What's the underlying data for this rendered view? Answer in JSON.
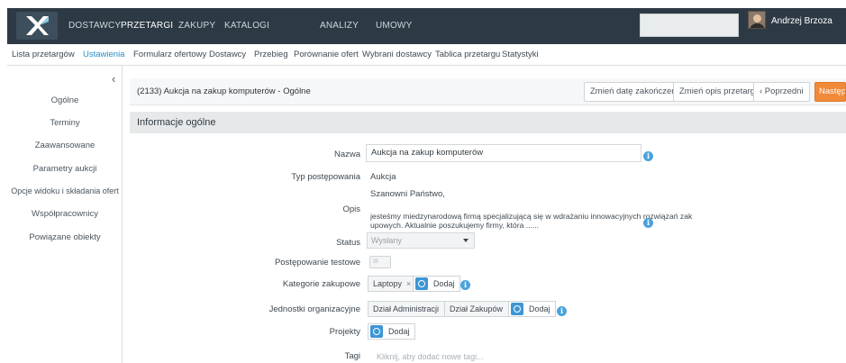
{
  "topbar": {
    "nav": [
      {
        "label": "DOSTAWCY",
        "active": false
      },
      {
        "label": "PRZETARGI",
        "active": true
      },
      {
        "label": "ZAKUPY",
        "active": false
      },
      {
        "label": "KATALOGI PRODUKTÓW",
        "active": false
      },
      {
        "label": "ANALIZY",
        "active": false
      },
      {
        "label": "UMOWY",
        "active": false
      }
    ],
    "user_name": "Andrzej Brzoza"
  },
  "subnav": {
    "tabs": [
      {
        "label": "Lista przetargów",
        "active": false
      },
      {
        "label": "Ustawienia",
        "active": true
      },
      {
        "label": "Formularz ofertowy",
        "active": false
      },
      {
        "label": "Dostawcy",
        "active": false
      },
      {
        "label": "Przebieg",
        "active": false
      },
      {
        "label": "Porównanie ofert",
        "active": false
      },
      {
        "label": "Wybrani dostawcy",
        "active": false
      },
      {
        "label": "Tablica przetargu",
        "active": false
      },
      {
        "label": "Statystyki",
        "active": false
      }
    ]
  },
  "sidebar": {
    "collapse_glyph": "‹",
    "items": [
      "Ogólne",
      "Terminy",
      "Zaawansowane",
      "Parametry aukcji",
      "Opcje widoku i składania ofert",
      "Współpracownicy",
      "Powiązane obiekty"
    ]
  },
  "header": {
    "title": "(2133) Aukcja na zakup komputerów - Ogólne",
    "buttons": {
      "change_end_date": "Zmień datę zakończenia",
      "change_description": "Zmień opis przetargu",
      "previous": "‹  Poprzedni",
      "next": "Następn"
    }
  },
  "section": {
    "title": "Informacje ogólne"
  },
  "form": {
    "name": {
      "label": "Nazwa",
      "value": "Aukcja na zakup komputerów"
    },
    "type": {
      "label": "Typ postępowania",
      "value": "Aukcja"
    },
    "description": {
      "label": "Opis",
      "line1": "Szanowni Państwo,",
      "line2": "jesteśmy miedzynarodową firmą specjalizującą się w wdrażaniu innowacyjnych rozwiązań zak",
      "line3": "upowych. Aktualnie poszukujemy firmy, która ......"
    },
    "status": {
      "label": "Status",
      "value": "Wysłany"
    },
    "test": {
      "label": "Postępowanie testowe",
      "value": "III"
    },
    "categories": {
      "label": "Kategorie zakupowe",
      "tags": [
        "Laptopy"
      ],
      "add": "Dodaj"
    },
    "units": {
      "label": "Jednostki organizacyjne",
      "tags": [
        "Dział Administracji",
        "Dział Zakupów"
      ],
      "add": "Dodaj"
    },
    "projects": {
      "label": "Projekty",
      "add": "Dodaj"
    },
    "tags": {
      "label": "Tagi",
      "placeholder": "Kliknij, aby dodać nowe tagi..."
    },
    "remove_glyph": "×",
    "info_glyph": "i"
  },
  "colors": {
    "topbar": "#2d3a45",
    "accent": "#2a8fc7",
    "next_button": "#f08a39",
    "info": "#4ba3dc"
  }
}
